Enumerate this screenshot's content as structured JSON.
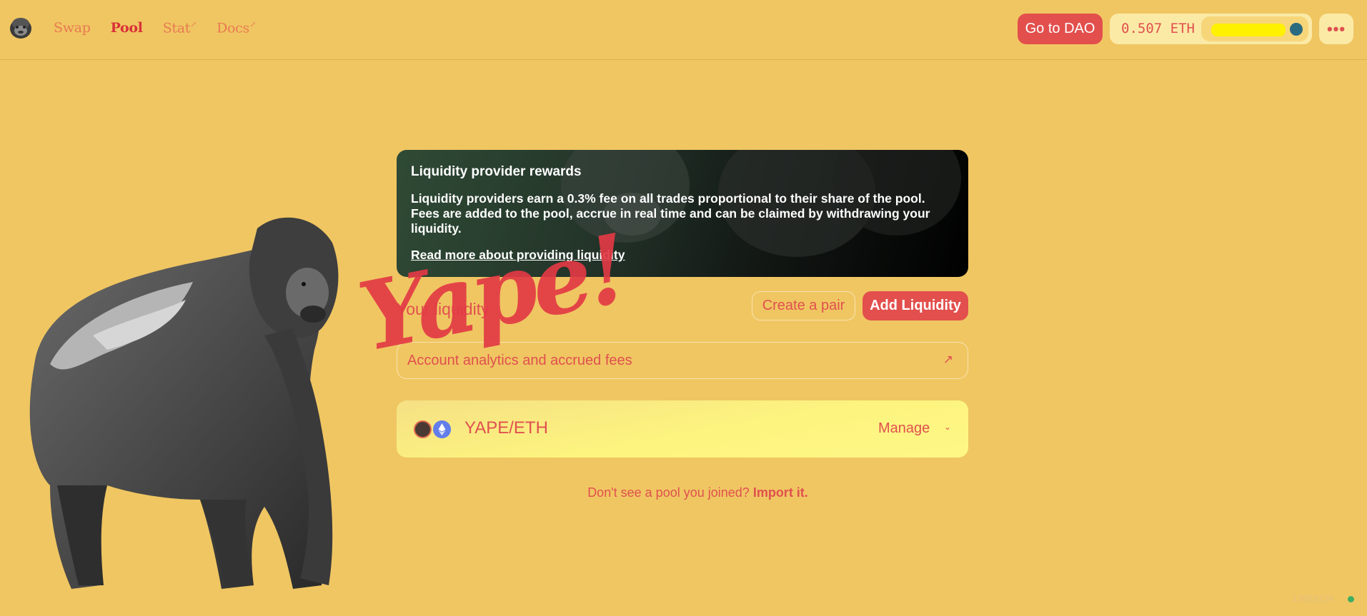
{
  "header": {
    "nav": [
      {
        "label": "Swap",
        "active": false,
        "external": false
      },
      {
        "label": "Pool",
        "active": true,
        "external": false
      },
      {
        "label": "Stat",
        "active": false,
        "external": true
      },
      {
        "label": "Docs",
        "active": false,
        "external": true
      }
    ],
    "external_marker": "↗",
    "dao_button": "Go to DAO",
    "balance": "0.507 ETH",
    "more_icon": "more-horizontal-icon"
  },
  "rewards_card": {
    "title": "Liquidity provider rewards",
    "text": "Liquidity providers earn a 0.3% fee on all trades proportional to their share of the pool. Fees are added to the pool, accrue in real time and can be claimed by withdrawing your liquidity.",
    "link": "Read more about providing liquidity"
  },
  "your_liquidity": {
    "title": "Your liquidity",
    "create_pair": "Create a pair",
    "add_liquidity": "Add Liquidity",
    "analytics": "Account analytics and accrued fees",
    "analytics_icon": "↗"
  },
  "watermark": "Yape!",
  "pool": {
    "pair": "YAPE/ETH",
    "manage": "Manage",
    "chevron": "⌄"
  },
  "import": {
    "text": "Don't see a pool you joined?",
    "link": "Import it."
  },
  "footer": {
    "block_number": "13088339"
  },
  "colors": {
    "background": "#f0c662",
    "accent": "#e24f4c",
    "text": "#e0504f",
    "pool_card": "#fdf47f"
  }
}
